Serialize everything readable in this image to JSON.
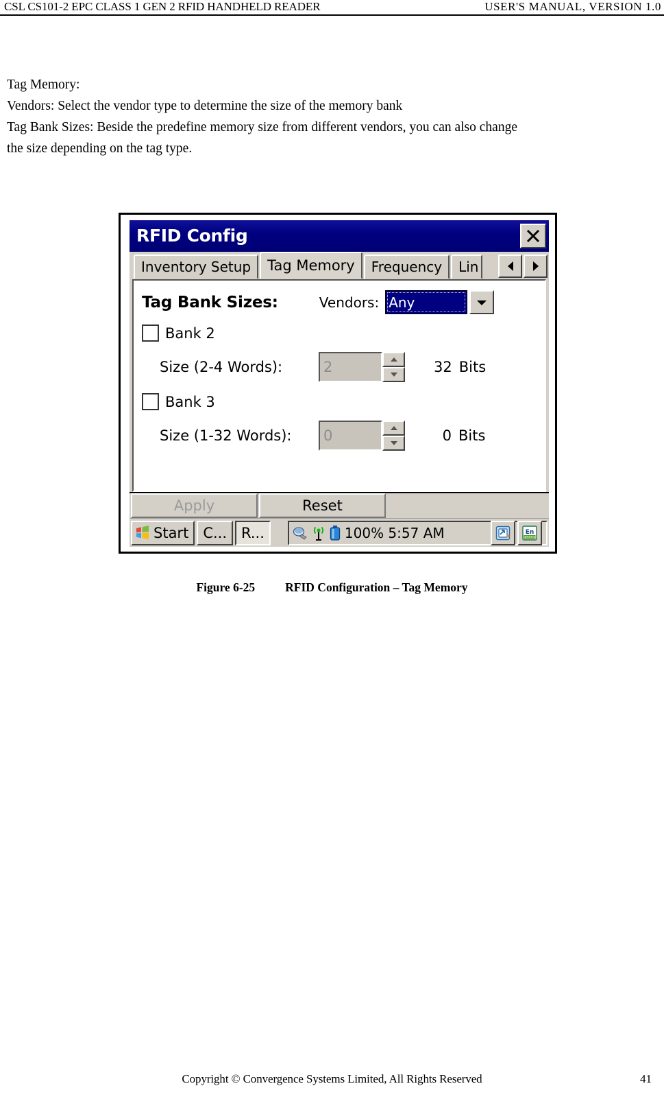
{
  "header": {
    "left": "CSL CS101-2 EPC CLASS 1 GEN 2 RFID HANDHELD READER",
    "right": "USER'S  MANUAL,  VERSION  1.0"
  },
  "body": {
    "line1": "Tag Memory:",
    "line2": "Vendors: Select the vendor type to determine the size of the memory bank",
    "line3": "Tag Bank Sizes: Beside the predefine memory size from different vendors, you can also change",
    "line4": "the size depending on the tag type."
  },
  "dialog": {
    "title": "RFID Config",
    "close_label": "X",
    "tabs": [
      {
        "label": "Inventory Setup",
        "active": false
      },
      {
        "label": "Tag Memory",
        "active": true
      },
      {
        "label": "Frequency",
        "active": false
      },
      {
        "label": "Lin",
        "active": false
      }
    ],
    "tab_scroll_left": "left-arrow-icon",
    "tab_scroll_right": "right-arrow-icon",
    "page": {
      "group_label": "Tag Bank Sizes:",
      "vendors_label": "Vendors:",
      "vendors_value": "Any",
      "bank2": {
        "checkbox_label": "Bank 2",
        "checked": false,
        "size_label": "Size (2-4 Words):",
        "size_value": "2",
        "bits_value": "32",
        "bits_unit": "Bits"
      },
      "bank3": {
        "checkbox_label": "Bank 3",
        "checked": false,
        "size_label": "Size (1-32 Words):",
        "size_value": "0",
        "bits_value": "0",
        "bits_unit": "Bits"
      }
    },
    "commands": {
      "apply": "Apply",
      "reset": "Reset"
    },
    "taskbar": {
      "start": "Start",
      "task1": "C...",
      "task2": "R...",
      "clock": "100% 5:57 AM",
      "icons": [
        "speaker-icon",
        "wireless-antenna-icon",
        "battery-icon"
      ],
      "tray_buttons": [
        "rotate-screen-icon",
        "input-method-en-icon"
      ]
    }
  },
  "caption": {
    "number": "Figure 6-25",
    "text": "RFID Configuration – Tag Memory"
  },
  "footer": {
    "copyright": "Copyright © Convergence Systems Limited, All Rights Reserved",
    "page_number": "41"
  },
  "colors": {
    "titlebar": "#000080",
    "selection": "#000080",
    "chrome": "#d4d0c8"
  }
}
